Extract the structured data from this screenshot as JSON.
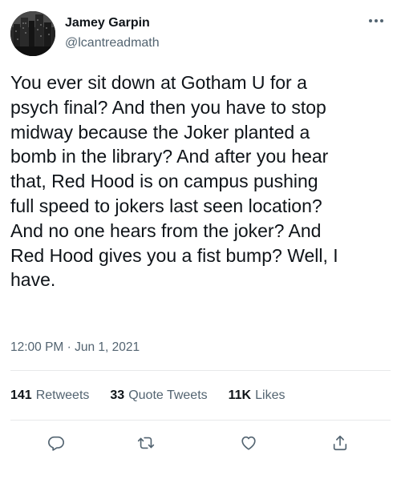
{
  "author": {
    "name": "Jamey Garpin",
    "handle": "@lcantreadmath"
  },
  "tweet": {
    "text": "You ever sit down at Gotham U for a\npsych final? And then you have to stop\nmidway because the Joker planted a\nbomb in the library? And after you hear\nthat, Red Hood is on campus pushing\nfull speed to jokers last seen location?\nAnd no one hears from the joker? And\nRed Hood gives you a fist bump? Well, I\nhave.",
    "timestamp": "12:00 PM · Jun 1, 2021"
  },
  "stats": {
    "retweets_count": "141",
    "retweets_label": "Retweets",
    "quotes_count": "33",
    "quotes_label": "Quote Tweets",
    "likes_count": "11K",
    "likes_label": "Likes"
  },
  "actions": {
    "reply_icon": "speech-bubble-icon",
    "retweet_icon": "retweet-arrows-icon",
    "like_icon": "heart-icon",
    "share_icon": "upload-arrow-icon"
  },
  "colors": {
    "text": "#0f1419",
    "secondary": "#536471",
    "divider": "#e7e9ea"
  }
}
